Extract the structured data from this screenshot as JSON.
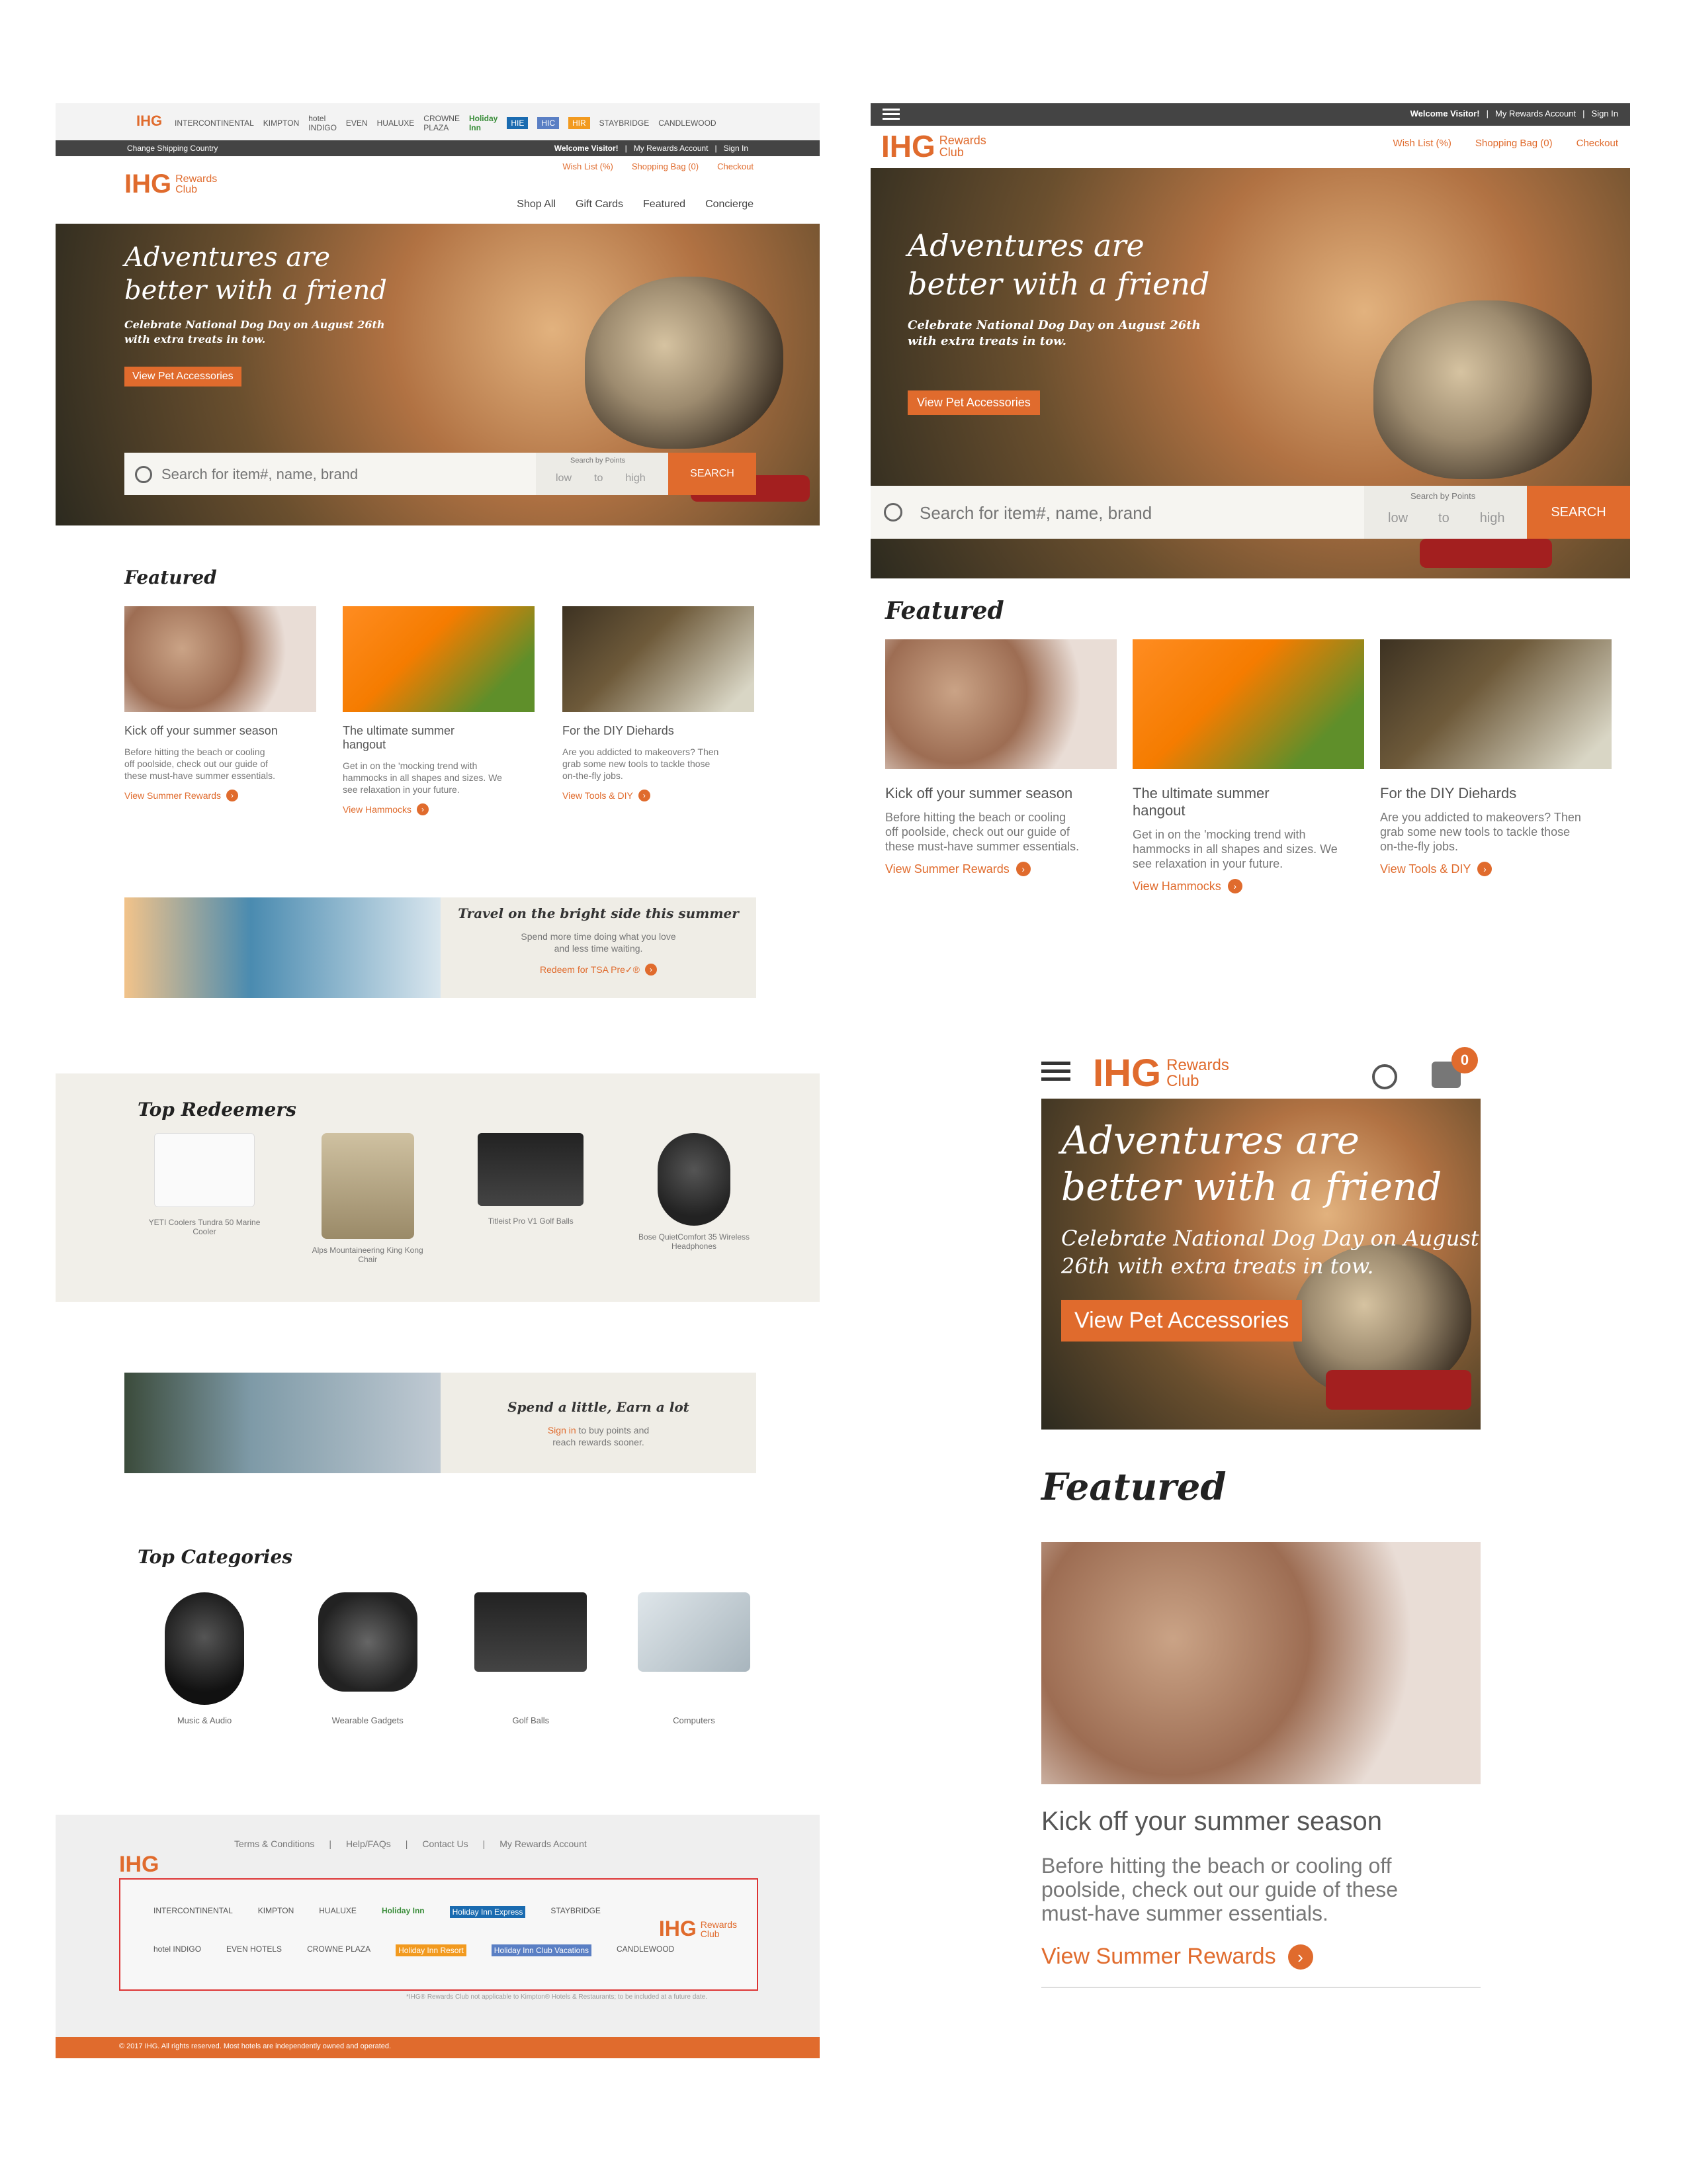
{
  "left": {
    "topbar": {
      "change_country": "Change Shipping Country",
      "welcome": "Welcome Visitor!",
      "my_account": "My Rewards Account",
      "sign_in": "Sign In",
      "wishlist": "Wish List (%)",
      "bag": "Shopping Bag (0)",
      "checkout": "Checkout"
    },
    "logo": {
      "ihg": "IHG",
      "rewards_1": "Rewards",
      "rewards_2": "Club"
    },
    "nav": [
      "Shop All",
      "Gift Cards",
      "Featured",
      "Concierge"
    ],
    "hero": {
      "title_1": "Adventures are",
      "title_2": "better with a friend",
      "subtitle_1": "Celebrate National Dog Day on August 26th",
      "subtitle_2": "with extra treats in tow.",
      "cta": "View Pet Accessories"
    },
    "search": {
      "placeholder": "Search for item#, name, brand",
      "by_points": "Search by Points",
      "low": "low",
      "to": "to",
      "high": "high",
      "button": "SEARCH"
    },
    "featured": {
      "title": "Featured",
      "items": [
        {
          "title": "Kick off your summer season",
          "desc_1": "Before hitting the beach or cooling",
          "desc_2": "off poolside, check out our guide of",
          "desc_3": "these must-have summer essentials.",
          "link": "View Summer Rewards"
        },
        {
          "title": "The ultimate summer",
          "title_2": "hangout",
          "desc_1": "Get in on the 'mocking trend with",
          "desc_2": "hammocks in all shapes and sizes. We",
          "desc_3": "see relaxation in your future.",
          "link": "View Hammocks"
        },
        {
          "title": "For the DIY Diehards",
          "desc_1": "Are you addicted to makeovers? Then",
          "desc_2": "grab some new tools to tackle those",
          "desc_3": "on-the-fly jobs.",
          "link": "View Tools & DIY"
        }
      ]
    },
    "banner1": {
      "title": "Travel on the bright side this summer",
      "desc_1": "Spend more time doing what you love",
      "desc_2": "and less time waiting.",
      "link": "Redeem for TSA Pre✓®"
    },
    "top_redeemers": {
      "title": "Top Redeemers",
      "items": [
        {
          "label_1": "YETI Coolers Tundra 50 Marine",
          "label_2": "Cooler"
        },
        {
          "label_1": "Alps Mountaineering King Kong",
          "label_2": "Chair"
        },
        {
          "label_1": "Titleist Pro V1 Golf Balls",
          "label_2": ""
        },
        {
          "label_1": "Bose QuietComfort 35 Wireless",
          "label_2": "Headphones"
        }
      ]
    },
    "banner2": {
      "title": "Spend a little, Earn a lot",
      "desc_link": "Sign in",
      "desc_rest": " to buy points and",
      "desc_2": "reach rewards sooner."
    },
    "top_categories": {
      "title": "Top Categories",
      "items": [
        "Music & Audio",
        "Wearable Gadgets",
        "Golf Balls",
        "Computers"
      ]
    },
    "footer": {
      "links": [
        "Terms & Conditions",
        "Help/FAQs",
        "Contact Us",
        "My Rewards Account"
      ],
      "ihg": "IHG",
      "brands_row1": [
        "INTERCONTINENTAL",
        "KIMPTON",
        "HUALUXE",
        "Holiday Inn",
        "Holiday Inn Express",
        "STAYBRIDGE"
      ],
      "brands_row2": [
        "hotel INDIGO",
        "EVEN HOTELS",
        "CROWNE PLAZA",
        "Holiday Inn Resort",
        "Holiday Inn Club Vacations",
        "CANDLEWOOD"
      ],
      "rewards_1": "Rewards",
      "rewards_2": "Club",
      "note": "*IHG® Rewards Club not applicable to Kimpton® Hotels & Restaurants; to be included at a future date.",
      "copyright": "© 2017 IHG. All rights reserved. Most hotels are independently owned and operated."
    }
  },
  "right": {
    "topbar": {
      "welcome": "Welcome Visitor!",
      "my_account": "My Rewards Account",
      "sign_in": "Sign In",
      "wishlist": "Wish List (%)",
      "bag": "Shopping Bag (0)",
      "checkout": "Checkout"
    },
    "logo": {
      "ihg": "IHG",
      "rewards_1": "Rewards",
      "rewards_2": "Club"
    },
    "hero": {
      "title_1": "Adventures are",
      "title_2": "better with a friend",
      "subtitle_1": "Celebrate National Dog Day on August 26th",
      "subtitle_2": "with extra treats in tow.",
      "cta": "View Pet Accessories"
    },
    "search": {
      "placeholder": "Search for item#, name, brand",
      "by_points": "Search by Points",
      "low": "low",
      "to": "to",
      "high": "high",
      "button": "SEARCH"
    },
    "featured": {
      "title": "Featured",
      "items": [
        {
          "title": "Kick off your summer season",
          "desc_1": "Before hitting the beach or cooling",
          "desc_2": "off poolside, check out our guide of",
          "desc_3": "these must-have summer essentials.",
          "link": "View Summer Rewards"
        },
        {
          "title": "The ultimate summer",
          "title_2": "hangout",
          "desc_1": "Get in on the 'mocking trend with",
          "desc_2": "hammocks in all shapes and sizes. We",
          "desc_3": "see relaxation in your future.",
          "link": "View Hammocks"
        },
        {
          "title": "For the DIY Diehards",
          "desc_1": "Are you addicted to makeovers? Then",
          "desc_2": "grab some new tools to tackle those",
          "desc_3": "on-the-fly jobs.",
          "link": "View Tools & DIY"
        }
      ]
    }
  },
  "mobile": {
    "logo": {
      "ihg": "IHG",
      "rewards_1": "Rewards",
      "rewards_2": "Club"
    },
    "cart_count": "0",
    "hero": {
      "title_1": "Adventures are",
      "title_2": "better with a friend",
      "subtitle_1": "Celebrate National Dog Day on August",
      "subtitle_2": "26th with extra treats in tow.",
      "cta": "View Pet Accessories"
    },
    "featured": {
      "title": "Featured",
      "item": {
        "title": "Kick off your summer season",
        "desc_1": "Before hitting the beach or cooling off",
        "desc_2": "poolside, check out our guide of these",
        "desc_3": "must-have summer essentials.",
        "link": "View Summer Rewards"
      }
    }
  },
  "colors": {
    "orange": "#e06b2d",
    "dark": "#3b3b3b",
    "beige": "#efede6"
  }
}
